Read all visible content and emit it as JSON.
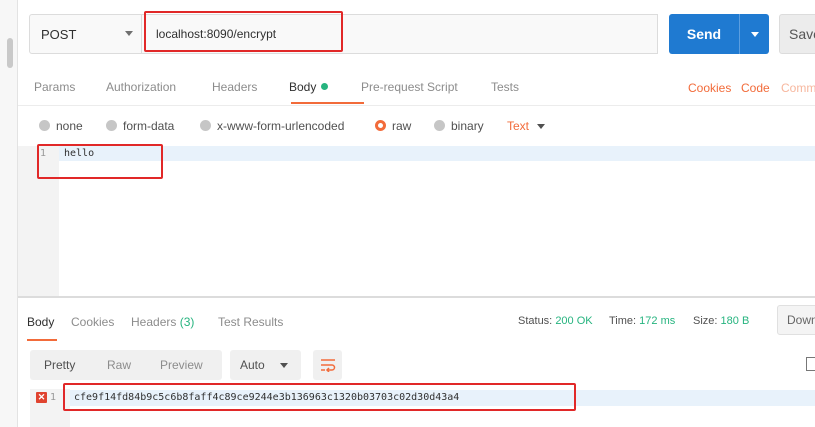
{
  "request": {
    "method": "POST",
    "url": "localhost:8090/encrypt",
    "send_label": "Send",
    "save_label": "Save"
  },
  "request_tabs": {
    "params": "Params",
    "authorization": "Authorization",
    "headers": "Headers",
    "body": "Body",
    "prerequest": "Pre-request Script",
    "tests": "Tests",
    "cookies": "Cookies",
    "code": "Code",
    "comments": "Comm"
  },
  "body_types": {
    "none": "none",
    "form_data": "form-data",
    "urlencoded": "x-www-form-urlencoded",
    "raw": "raw",
    "binary": "binary",
    "text_type": "Text"
  },
  "request_editor": {
    "line_number": "1",
    "content": "hello"
  },
  "response_tabs": {
    "body": "Body",
    "cookies": "Cookies",
    "headers": "Headers",
    "headers_count": "(3)",
    "test_results": "Test Results"
  },
  "response_stats": {
    "status_label": "Status:",
    "status_value": "200 OK",
    "time_label": "Time:",
    "time_value": "172 ms",
    "size_label": "Size:",
    "size_value": "180 B",
    "download_label": "Down"
  },
  "view_modes": {
    "pretty": "Pretty",
    "raw": "Raw",
    "preview": "Preview",
    "format": "Auto"
  },
  "response_editor": {
    "line_number": "1",
    "content": "cfe9f14fd84b9c5c6b8faff4c89ce9244e3b136963c1320b03703c02d30d43a4"
  },
  "colors": {
    "accent": "#f26b3a",
    "send_button": "#1f7ad1",
    "success": "#26b47f",
    "annotation": "#e12828"
  }
}
